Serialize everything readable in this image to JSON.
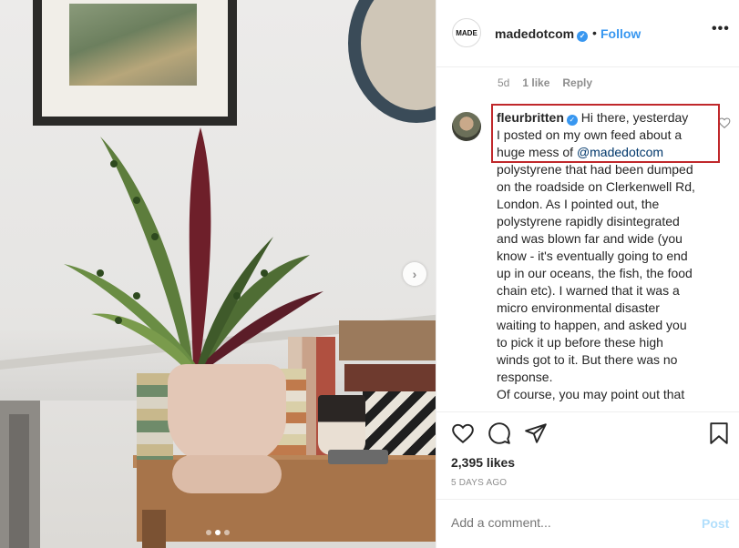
{
  "post": {
    "header": {
      "avatar_text": "MADE",
      "username": "madedotcom",
      "separator": "•",
      "follow_label": "Follow",
      "more_icon": "more-dots-icon"
    },
    "previous_comment_meta": {
      "age": "5d",
      "likes": "1 like",
      "reply_label": "Reply"
    },
    "comment": {
      "username": "fleurbritten",
      "text_before_mention": " Hi there, yesterday I posted on my own feed about a huge mess of ",
      "mention": "@madedotcom",
      "text_after_mention": " polystyrene that had been dumped on the roadside on Clerkenwell Rd, London. As I pointed out, the polystyrene rapidly disintegrated and was blown far and wide (you know - it's eventually going to end up in our oceans, the fish, the food chain etc). I warned that it was a micro environmental disaster waiting to happen, and asked you to pick it up before these high winds got to it. But there was no response.",
      "text_cont": "Of course, you may point out that"
    },
    "likes_text": "2,395 likes",
    "date_text": "5 DAYS AGO",
    "add_comment_placeholder": "Add a comment...",
    "post_label": "Post",
    "photo": {
      "next_icon": "chevron-right-icon",
      "carousel_count": 3,
      "carousel_active_index": 1
    }
  },
  "colors": {
    "accent_blue": "#3897f0",
    "highlight_red": "#c0282b",
    "post_disabled": "#b2dffc",
    "muted_text": "#8e8e8e"
  }
}
